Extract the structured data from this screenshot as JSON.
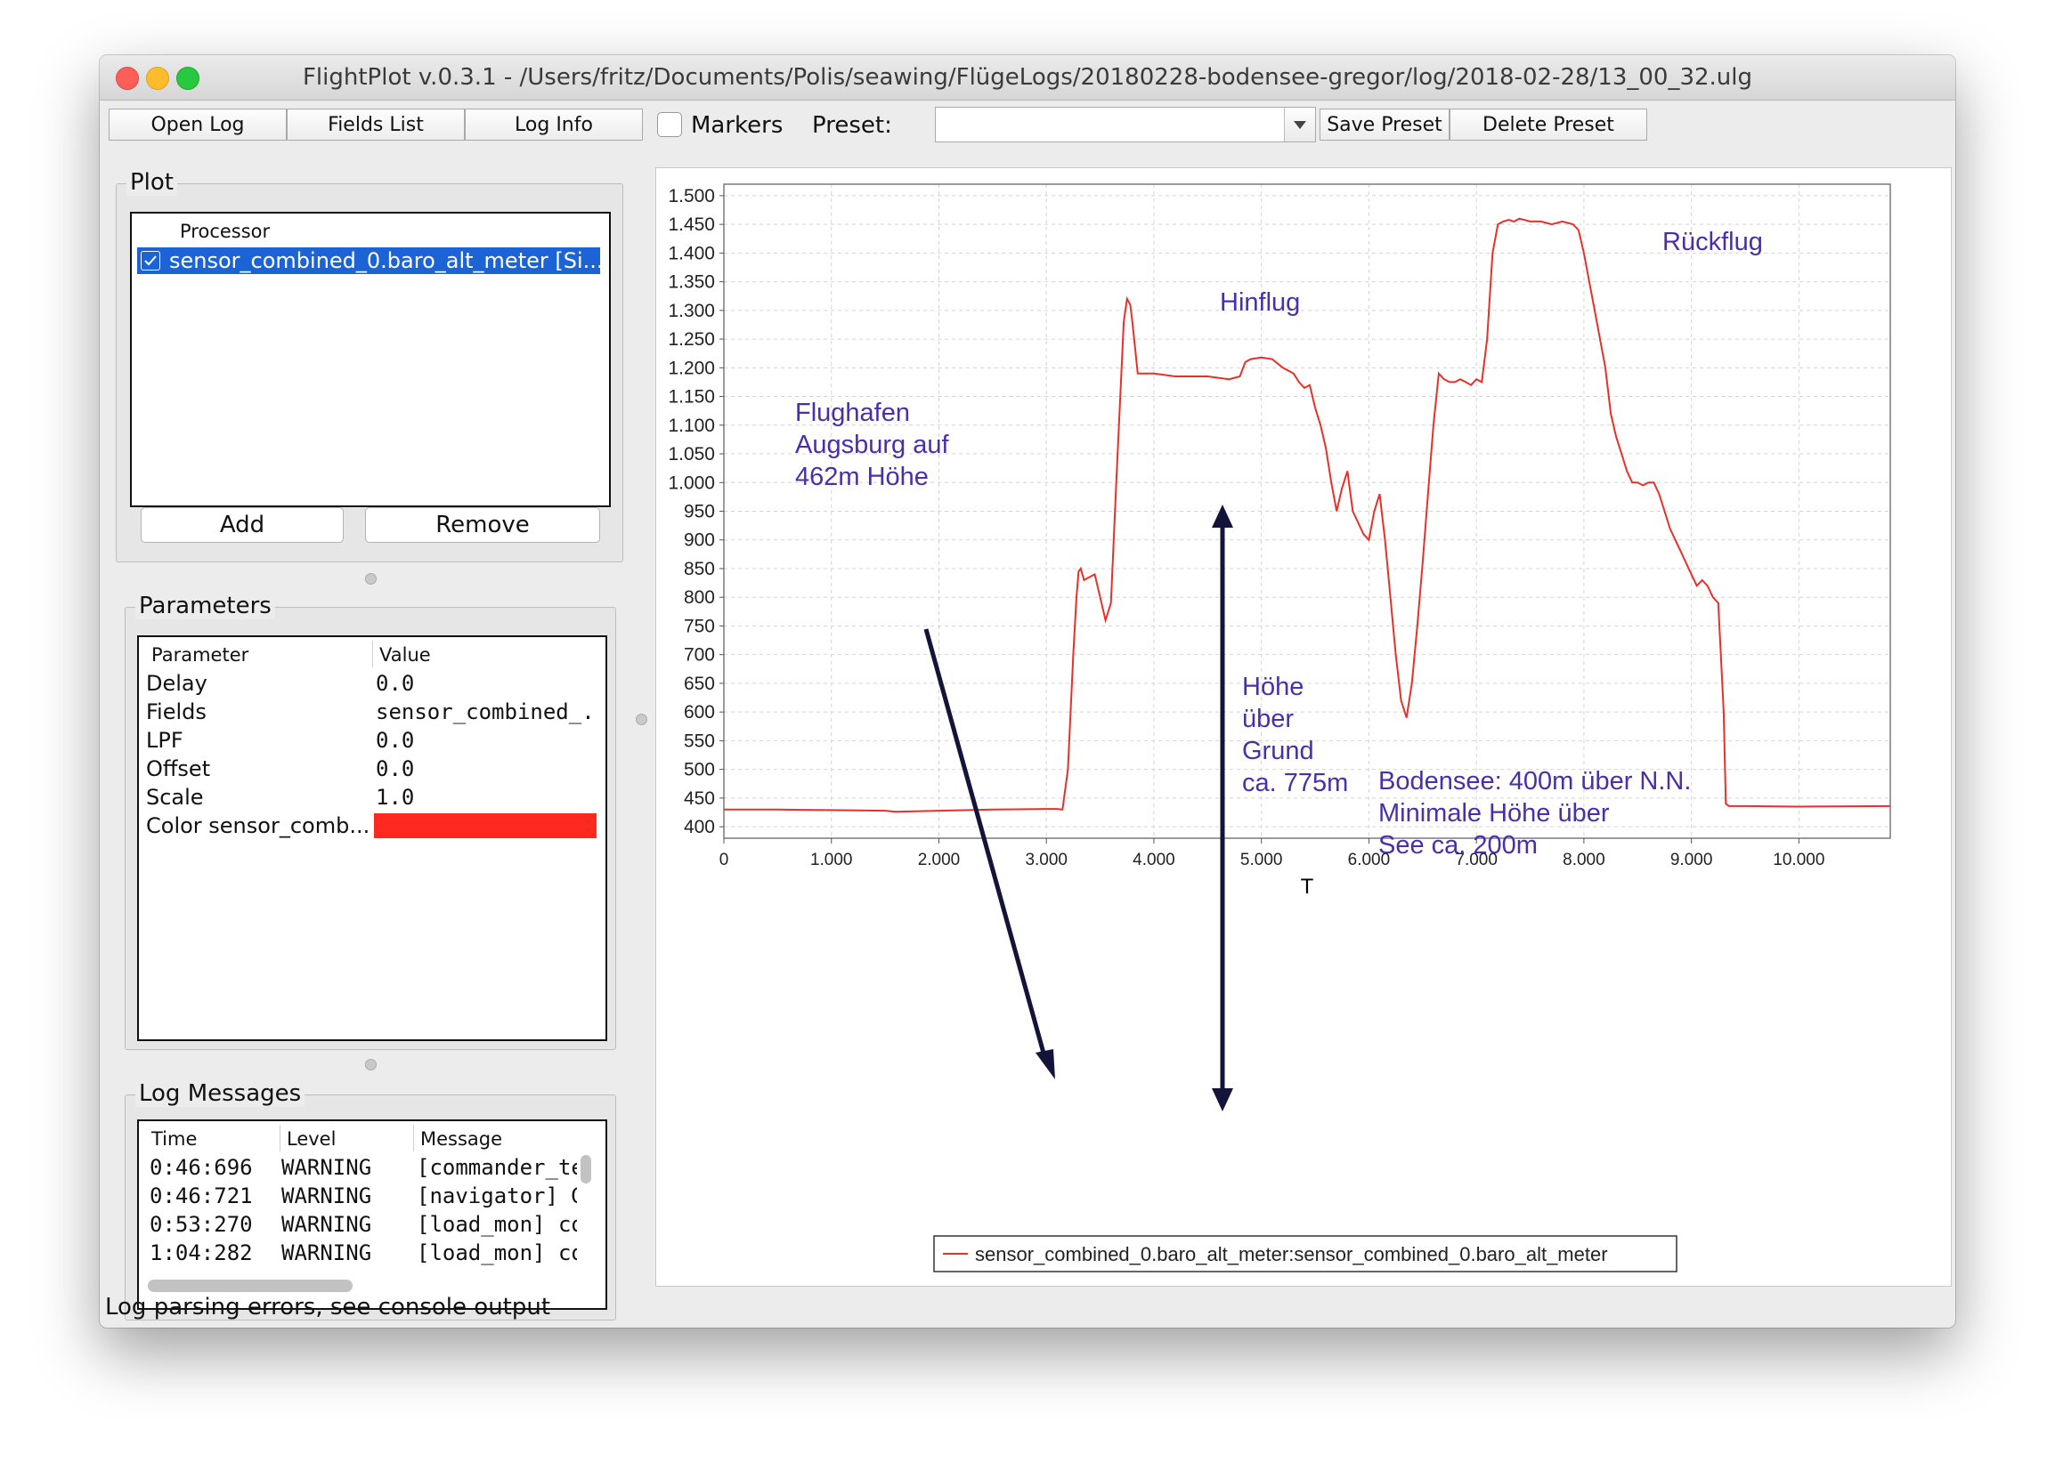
{
  "window": {
    "title": "FlightPlot v.0.3.1 - /Users/fritz/Documents/Polis/seawing/FlügeLogs/20180228-bodensee-gregor/log/2018-02-28/13_00_32.ulg"
  },
  "toolbar": {
    "open_log": "Open Log",
    "fields_list": "Fields List",
    "log_info": "Log Info",
    "markers_label": "Markers",
    "markers_checked": false,
    "preset_label": "Preset:",
    "preset_value": "",
    "save_preset": "Save Preset",
    "delete_preset": "Delete Preset"
  },
  "plot_panel": {
    "title": "Plot",
    "column_header": "Processor",
    "items": [
      {
        "checked": true,
        "label": "sensor_combined_0.baro_alt_meter [Si..."
      }
    ],
    "add_button": "Add",
    "remove_button": "Remove"
  },
  "parameters_panel": {
    "title": "Parameters",
    "col_parameter": "Parameter",
    "col_value": "Value",
    "rows": [
      {
        "name": "Delay",
        "value": "0.0"
      },
      {
        "name": "Fields",
        "value": "sensor_combined_..."
      },
      {
        "name": "LPF",
        "value": "0.0"
      },
      {
        "name": "Offset",
        "value": "0.0"
      },
      {
        "name": "Scale",
        "value": "1.0"
      },
      {
        "name": "Color sensor_comb...",
        "value": ""
      }
    ],
    "color_swatch": "#ff2a1f"
  },
  "log_messages_panel": {
    "title": "Log Messages",
    "col_time": "Time",
    "col_level": "Level",
    "col_message": "Message",
    "rows": [
      {
        "time": "0:46:696",
        "level": "WARNING",
        "message": "[commander_te"
      },
      {
        "time": "0:46:721",
        "level": "WARNING",
        "message": "[navigator] Glol"
      },
      {
        "time": "0:53:270",
        "level": "WARNING",
        "message": "[load_mon] cor"
      },
      {
        "time": "1:04:282",
        "level": "WARNING",
        "message": "[load_mon] cor"
      }
    ]
  },
  "status_bar": {
    "text": "Log parsing errors, see console output"
  },
  "colors": {
    "series": "#e8302a",
    "annotation_text": "#4a2fa8",
    "arrow": "#14143a",
    "selection": "#1c63d6"
  },
  "chart_data": {
    "type": "line",
    "xlabel": "T",
    "ylabel": "",
    "xlim": [
      0,
      10850
    ],
    "ylim": [
      380,
      1520
    ],
    "xticks": [
      "0",
      "1.000",
      "2.000",
      "3.000",
      "4.000",
      "5.000",
      "6.000",
      "7.000",
      "8.000",
      "9.000",
      "10.000"
    ],
    "yticks": [
      "400",
      "450",
      "500",
      "550",
      "600",
      "650",
      "700",
      "750",
      "800",
      "850",
      "900",
      "950",
      "1.000",
      "1.050",
      "1.100",
      "1.150",
      "1.200",
      "1.250",
      "1.300",
      "1.350",
      "1.400",
      "1.450",
      "1.500"
    ],
    "grid": true,
    "legend_position": "bottom",
    "series": [
      {
        "name": "sensor_combined_0.baro_alt_meter:sensor_combined_0.baro_alt_meter",
        "x": [
          0,
          500,
          1000,
          1500,
          1600,
          2000,
          2500,
          3000,
          3100,
          3150,
          3200,
          3250,
          3280,
          3300,
          3320,
          3350,
          3400,
          3450,
          3500,
          3550,
          3600,
          3650,
          3700,
          3720,
          3750,
          3780,
          3800,
          3850,
          3900,
          4000,
          4200,
          4500,
          4700,
          4800,
          4850,
          4900,
          5000,
          5100,
          5200,
          5300,
          5350,
          5400,
          5450,
          5500,
          5550,
          5600,
          5650,
          5700,
          5750,
          5800,
          5850,
          5900,
          5950,
          6000,
          6050,
          6100,
          6150,
          6200,
          6250,
          6300,
          6350,
          6400,
          6450,
          6500,
          6550,
          6600,
          6650,
          6700,
          6750,
          6800,
          6850,
          6900,
          6950,
          7000,
          7050,
          7100,
          7150,
          7200,
          7250,
          7300,
          7350,
          7400,
          7500,
          7600,
          7700,
          7800,
          7900,
          7950,
          8000,
          8050,
          8100,
          8150,
          8200,
          8250,
          8300,
          8350,
          8400,
          8450,
          8500,
          8550,
          8600,
          8650,
          8700,
          8750,
          8800,
          8850,
          8900,
          8950,
          9000,
          9050,
          9100,
          9150,
          9200,
          9250,
          9300,
          9320,
          9350,
          9400,
          9500,
          10000,
          10850
        ],
        "y": [
          430,
          430,
          429,
          428,
          426,
          428,
          430,
          431,
          431,
          430,
          500,
          700,
          800,
          845,
          850,
          830,
          835,
          840,
          800,
          760,
          790,
          1000,
          1200,
          1280,
          1320,
          1310,
          1280,
          1190,
          1190,
          1190,
          1185,
          1185,
          1180,
          1185,
          1210,
          1215,
          1218,
          1215,
          1200,
          1190,
          1175,
          1165,
          1170,
          1130,
          1100,
          1060,
          1000,
          950,
          990,
          1020,
          950,
          930,
          910,
          900,
          950,
          980,
          900,
          800,
          700,
          620,
          590,
          650,
          750,
          860,
          980,
          1100,
          1190,
          1180,
          1175,
          1175,
          1180,
          1175,
          1170,
          1180,
          1175,
          1250,
          1400,
          1450,
          1455,
          1458,
          1455,
          1460,
          1455,
          1455,
          1450,
          1455,
          1450,
          1440,
          1400,
          1350,
          1300,
          1250,
          1200,
          1120,
          1080,
          1050,
          1020,
          1000,
          1000,
          995,
          1000,
          1000,
          980,
          950,
          920,
          900,
          880,
          860,
          840,
          820,
          830,
          820,
          800,
          790,
          600,
          440,
          436,
          436,
          436,
          435,
          436
        ]
      }
    ],
    "annotations": [
      "Flughafen",
      "Augsburg auf",
      "462m Höhe",
      "Hinflug",
      "Rückflug",
      "Höhe",
      "über",
      "Grund",
      "ca. 775m",
      "Bodensee: 400m über N.N.",
      "Minimale Höhe über",
      "See ca. 200m"
    ]
  }
}
